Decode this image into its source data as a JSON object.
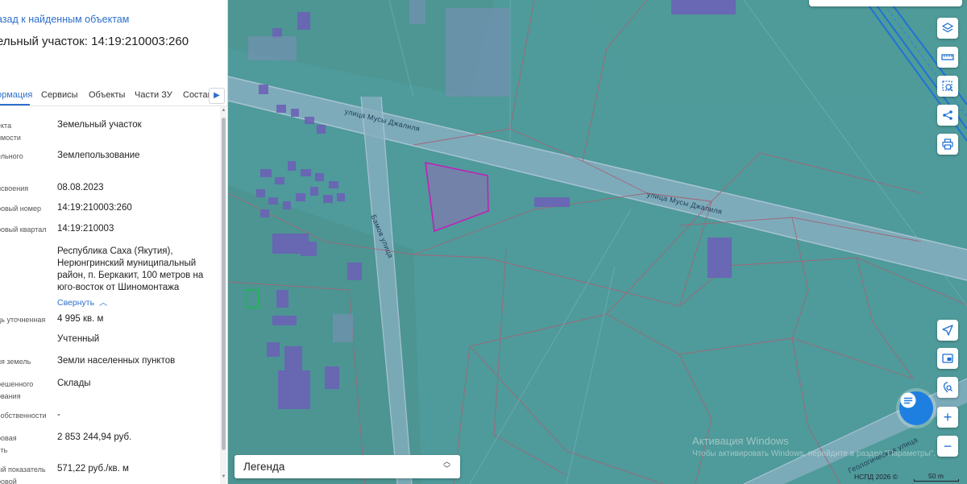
{
  "panel": {
    "back_link": "азад к найденным объектам",
    "title": "ельный участок: 14:19:210003:260",
    "tabs": [
      {
        "label": "ормация",
        "active": true
      },
      {
        "label": "Сервисы",
        "active": false
      },
      {
        "label": "Объекты",
        "active": false
      },
      {
        "label": "Части ЗУ",
        "active": false
      },
      {
        "label": "Состав",
        "active": false
      }
    ],
    "tab_next_icon": "chevron-right-icon",
    "fields": [
      {
        "label_lines": [
          "екта",
          "имости"
        ],
        "value_lines": [
          "Земельный участок"
        ]
      },
      {
        "label_lines": [
          "ельного"
        ],
        "value_lines": [
          "Землепользование"
        ]
      },
      {
        "label_lines": [
          "исвоения"
        ],
        "value_lines": [
          "08.08.2023"
        ]
      },
      {
        "label_lines": [
          "ровый номер"
        ],
        "value_lines": [
          "14:19:210003:260"
        ]
      },
      {
        "label_lines": [
          "ровый квартал"
        ],
        "value_lines": [
          "14:19:210003"
        ]
      },
      {
        "label_lines": [],
        "value_lines": [
          "Республика Саха (Якутия),",
          "Нерюнгринский муниципальный",
          "район, п. Беркакит, 100 метров на",
          "юго-восток от Шиномонтажа"
        ]
      },
      {
        "label_lines": [
          "дь уточненная"
        ],
        "value_lines": [
          "4 995 кв. м"
        ]
      },
      {
        "label_lines": [],
        "value_lines": [
          "Учтенный"
        ]
      },
      {
        "label_lines": [
          "ия земель"
        ],
        "value_lines": [
          "Земли населенных пунктов"
        ]
      },
      {
        "label_lines": [
          "решенного",
          "ования"
        ],
        "value_lines": [
          "Склады"
        ]
      },
      {
        "label_lines": [
          "собственности"
        ],
        "value_lines": [
          "-"
        ]
      },
      {
        "label_lines": [
          "ровая",
          "сть"
        ],
        "value_lines": [
          "2 853 244,94 руб."
        ]
      },
      {
        "label_lines": [
          "ый показатель",
          "ровой"
        ],
        "value_lines": [
          "571,22 руб./кв. м"
        ]
      }
    ],
    "collapse_link": "Свернуть"
  },
  "map": {
    "streets": [
      "улица Мусы Джалиля",
      "улица Мусы Джалиля",
      "Бамов улица",
      "Геологическая улица"
    ],
    "legend_label": "Легенда",
    "watermark_title": "Активация Windows",
    "watermark_sub": "Чтобы активировать Windows, перейдите в раздел \"Параметры\".",
    "copyright": "НСПД 2026 ©",
    "scale": "50 m",
    "controls": [
      "layers-icon",
      "ruler-icon",
      "area-select-icon",
      "share-icon",
      "print-icon",
      "locate-icon",
      "minimap-icon",
      "geo-search-icon",
      "zoom-in-icon",
      "zoom-out-icon"
    ],
    "zoom_in_label": "+",
    "zoom_out_label": "−"
  },
  "colors": {
    "map_bg": "#4f9a9a",
    "accent_blue": "#2d6fcc",
    "selected_parcel_stroke": "#c21fb8",
    "building_fill": "#6c5fb8",
    "road": "#8cb1c6",
    "chat_button": "#1f7fe0"
  }
}
